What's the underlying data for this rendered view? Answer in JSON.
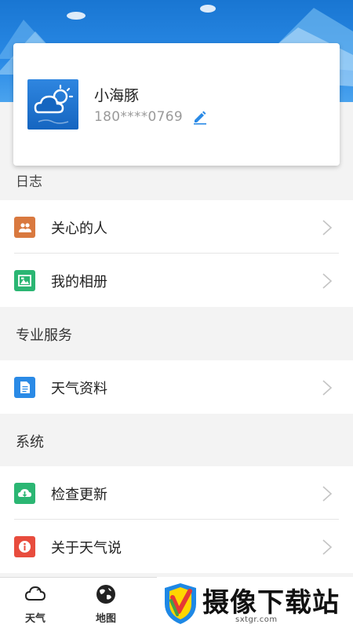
{
  "profile": {
    "username": "小海豚",
    "phone": "180****0769"
  },
  "partial_section_label": "日志",
  "groups": [
    {
      "items": [
        {
          "label": "关心的人",
          "icon": "people-icon",
          "color": "#d9793f"
        },
        {
          "label": "我的相册",
          "icon": "album-icon",
          "color": "#2bb673"
        }
      ]
    },
    {
      "header": "专业服务",
      "items": [
        {
          "label": "天气资料",
          "icon": "document-icon",
          "color": "#2a8ae6"
        }
      ]
    },
    {
      "header": "系统",
      "items": [
        {
          "label": "检查更新",
          "icon": "cloud-download-icon",
          "color": "#2bb673"
        },
        {
          "label": "关于天气说",
          "icon": "info-icon",
          "color": "#e84c3d"
        }
      ]
    }
  ],
  "tabs": [
    {
      "label": "天气",
      "icon": "cloud-icon"
    },
    {
      "label": "地图",
      "icon": "globe-icon"
    }
  ],
  "watermark": {
    "title": "摄像下载站",
    "subtitle": "sxtgr.com"
  },
  "colors": {
    "header_blue": "#1976d2",
    "accent_blue": "#2a8ae6"
  }
}
